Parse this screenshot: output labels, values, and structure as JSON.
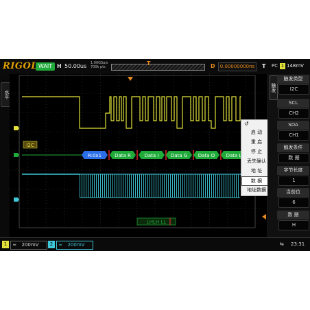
{
  "top": {
    "logo": "RIGOL",
    "run_state": "WAIT",
    "h_label": "H",
    "timebase": "50.00us",
    "sample_rate": "1.00GSa/s",
    "memory_depth": "700k pts",
    "trigger_marker": "T",
    "delay_label": "D",
    "trigger_offset": "0.00000000ns",
    "trigger_label": "T",
    "trigger_type": "PC",
    "trigger_source": "1",
    "trigger_level": "148mV"
  },
  "left_menu": {
    "tab_label": "水平"
  },
  "decode": {
    "bus_label": "I2C",
    "packets": [
      "R:0x1",
      "Data R",
      "Data I",
      "Data G",
      "Data O",
      "Data L"
    ],
    "trigger_label": "LHLH LL"
  },
  "side_menu": {
    "header": "触发",
    "items": [
      {
        "label": "触发类型",
        "value": "I2C"
      },
      {
        "label": "SCL",
        "value": "CH2"
      },
      {
        "label": "SDA",
        "value": "CH1"
      },
      {
        "label": "触发条件",
        "value": "数  据"
      },
      {
        "label": "字节长度",
        "value": "1"
      },
      {
        "label": "当前位",
        "value": "6"
      },
      {
        "label": "数  据",
        "value": "H"
      }
    ]
  },
  "popup": {
    "items": [
      "启  动",
      "重  启",
      "停  止",
      "丢失确认",
      "地  址",
      "数  据",
      "地址数据"
    ],
    "selected": "数  据"
  },
  "bottom": {
    "ch1_number": "1",
    "ch1_scale": "200mV",
    "ch2_number": "2",
    "ch2_scale": "200mV",
    "time": "23:31"
  },
  "colors": {
    "ch1": "#e2e23a",
    "ch2": "#3ec8d8",
    "decode_packet": "#1faa3a",
    "decode_address": "#2a6ee8",
    "decode_marker": "#e0262a",
    "trigger": "#e58a1f"
  },
  "icons": [
    "undo-icon",
    "usb-icon",
    "trigger-marker-icon"
  ]
}
